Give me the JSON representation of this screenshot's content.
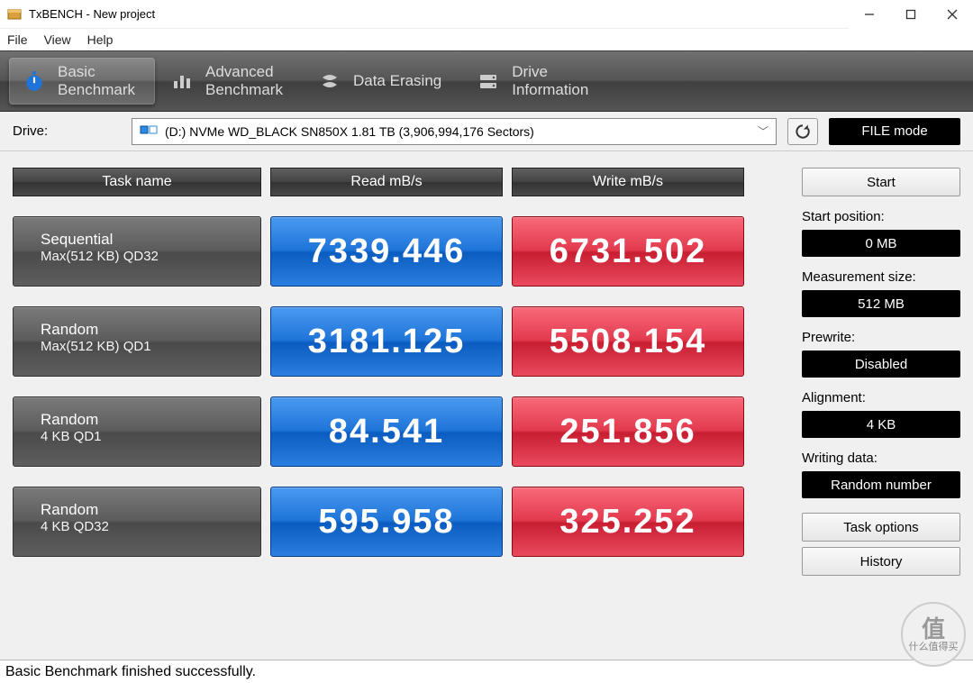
{
  "window": {
    "title": "TxBENCH - New project"
  },
  "menu": {
    "file": "File",
    "view": "View",
    "help": "Help"
  },
  "tabs": {
    "basic": {
      "line1": "Basic",
      "line2": "Benchmark"
    },
    "advanced": {
      "line1": "Advanced",
      "line2": "Benchmark"
    },
    "erasing": {
      "line1": "Data Erasing",
      "line2": ""
    },
    "drive": {
      "line1": "Drive",
      "line2": "Information"
    }
  },
  "drive": {
    "label": "Drive:",
    "selected": "(D:) NVMe WD_BLACK SN850X  1.81 TB (3,906,994,176 Sectors)",
    "file_mode": "FILE mode"
  },
  "headers": {
    "task": "Task name",
    "read": "Read mB/s",
    "write": "Write mB/s"
  },
  "rows": [
    {
      "title": "Sequential",
      "sub": "Max(512 KB) QD32",
      "read": "7339.446",
      "write": "6731.502"
    },
    {
      "title": "Random",
      "sub": "Max(512 KB) QD1",
      "read": "3181.125",
      "write": "5508.154"
    },
    {
      "title": "Random",
      "sub": "4 KB QD1",
      "read": "84.541",
      "write": "251.856"
    },
    {
      "title": "Random",
      "sub": "4 KB QD32",
      "read": "595.958",
      "write": "325.252"
    }
  ],
  "sidebar": {
    "start": "Start",
    "start_pos_lbl": "Start position:",
    "start_pos_val": "0 MB",
    "meas_lbl": "Measurement size:",
    "meas_val": "512 MB",
    "prewrite_lbl": "Prewrite:",
    "prewrite_val": "Disabled",
    "align_lbl": "Alignment:",
    "align_val": "4 KB",
    "wdata_lbl": "Writing data:",
    "wdata_val": "Random number",
    "task_options": "Task options",
    "history": "History"
  },
  "status": "Basic Benchmark finished successfully.",
  "watermark": {
    "char": "值",
    "text": "什么值得买"
  },
  "chart_data": {
    "type": "table",
    "title": "TxBENCH Basic Benchmark",
    "columns": [
      "Task",
      "Read MB/s",
      "Write MB/s"
    ],
    "rows": [
      [
        "Sequential Max(512 KB) QD32",
        7339.446,
        6731.502
      ],
      [
        "Random Max(512 KB) QD1",
        3181.125,
        5508.154
      ],
      [
        "Random 4 KB QD1",
        84.541,
        251.856
      ],
      [
        "Random 4 KB QD32",
        595.958,
        325.252
      ]
    ]
  }
}
